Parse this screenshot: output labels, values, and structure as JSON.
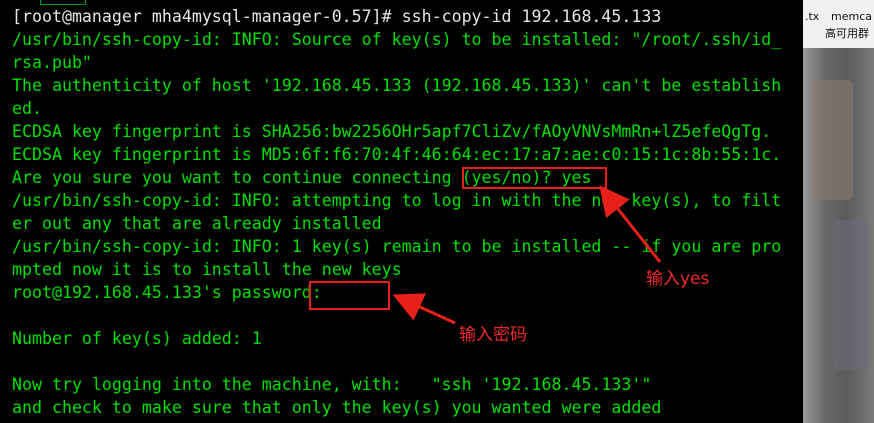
{
  "terminal": {
    "lines": [
      {
        "text": "[root@manager mha4mysql-manager-0.57]# ssh-copy-id 192.168.45.133",
        "color": "white"
      },
      {
        "text": "/usr/bin/ssh-copy-id: INFO: Source of key(s) to be installed: \"/root/.ssh/id_",
        "color": "green"
      },
      {
        "text": "rsa.pub\"",
        "color": "green"
      },
      {
        "text": "The authenticity of host '192.168.45.133 (192.168.45.133)' can't be establish",
        "color": "green"
      },
      {
        "text": "ed.",
        "color": "green"
      },
      {
        "text": "ECDSA key fingerprint is SHA256:bw2256OHr5apf7CliZv/fAOyVNVsMmRn+lZ5efeQgTg.",
        "color": "green"
      },
      {
        "text": "ECDSA key fingerprint is MD5:6f:f6:70:4f:46:64:ec:17:a7:ae:c0:15:1c:8b:55:1c.",
        "color": "green"
      },
      {
        "text": "Are you sure you want to continue connecting (yes/no)? yes",
        "color": "green"
      },
      {
        "text": "/usr/bin/ssh-copy-id: INFO: attempting to log in with the new key(s), to filt",
        "color": "green"
      },
      {
        "text": "er out any that are already installed",
        "color": "green"
      },
      {
        "text": "/usr/bin/ssh-copy-id: INFO: 1 key(s) remain to be installed -- if you are pro",
        "color": "green"
      },
      {
        "text": "mpted now it is to install the new keys",
        "color": "green"
      },
      {
        "text": "root@192.168.45.133's password:",
        "color": "green"
      },
      {
        "text": "",
        "color": "green"
      },
      {
        "text": "Number of key(s) added: 1",
        "color": "green"
      },
      {
        "text": "",
        "color": "green"
      },
      {
        "text": "Now try logging into the machine, with:   \"ssh '192.168.45.133'\"",
        "color": "green"
      },
      {
        "text": "and check to make sure that only the key(s) you wanted were added",
        "color": "green"
      }
    ]
  },
  "annotations": {
    "yes_note": "输入yes",
    "password_note": "输入密码",
    "color": "#e8201a"
  },
  "side_panel": {
    "file_ext": ".tx",
    "file_name": "memca",
    "file_sub": "高可用群"
  }
}
